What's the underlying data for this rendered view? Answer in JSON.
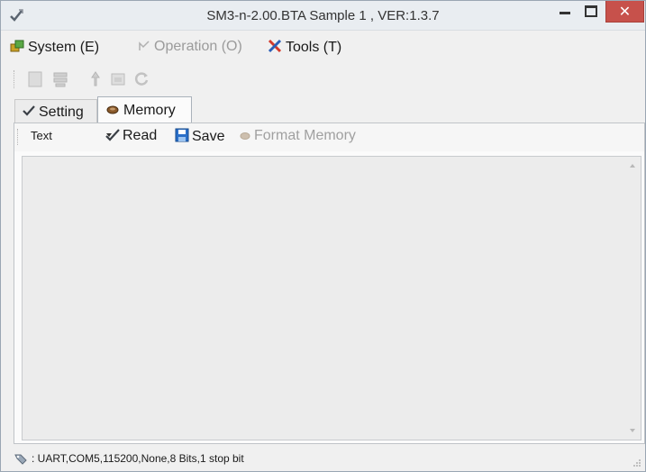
{
  "window": {
    "title": "SM3-n-2.00.BTA Sample 1 , VER:1.3.7",
    "close_label": "✕",
    "accent_close": "#c7514b"
  },
  "menu": {
    "system": "System (E)",
    "operation": "Operation (O)",
    "tools": "Tools (T)"
  },
  "toolbar_icons": [
    "document-icon",
    "tree-icon",
    "pin-icon",
    "window-icon",
    "refresh-icon"
  ],
  "tabs": [
    {
      "label": "Setting",
      "icon": "checkmark-icon",
      "active": false
    },
    {
      "label": "Memory",
      "icon": "memory-icon",
      "active": true
    }
  ],
  "memory_toolbar": {
    "format_select": "Text",
    "read_label": "Read",
    "save_label": "Save",
    "format_memory_label": "Format Memory"
  },
  "status": {
    "text": ": UART,COM5,115200,None,8 Bits,1 stop bit"
  }
}
